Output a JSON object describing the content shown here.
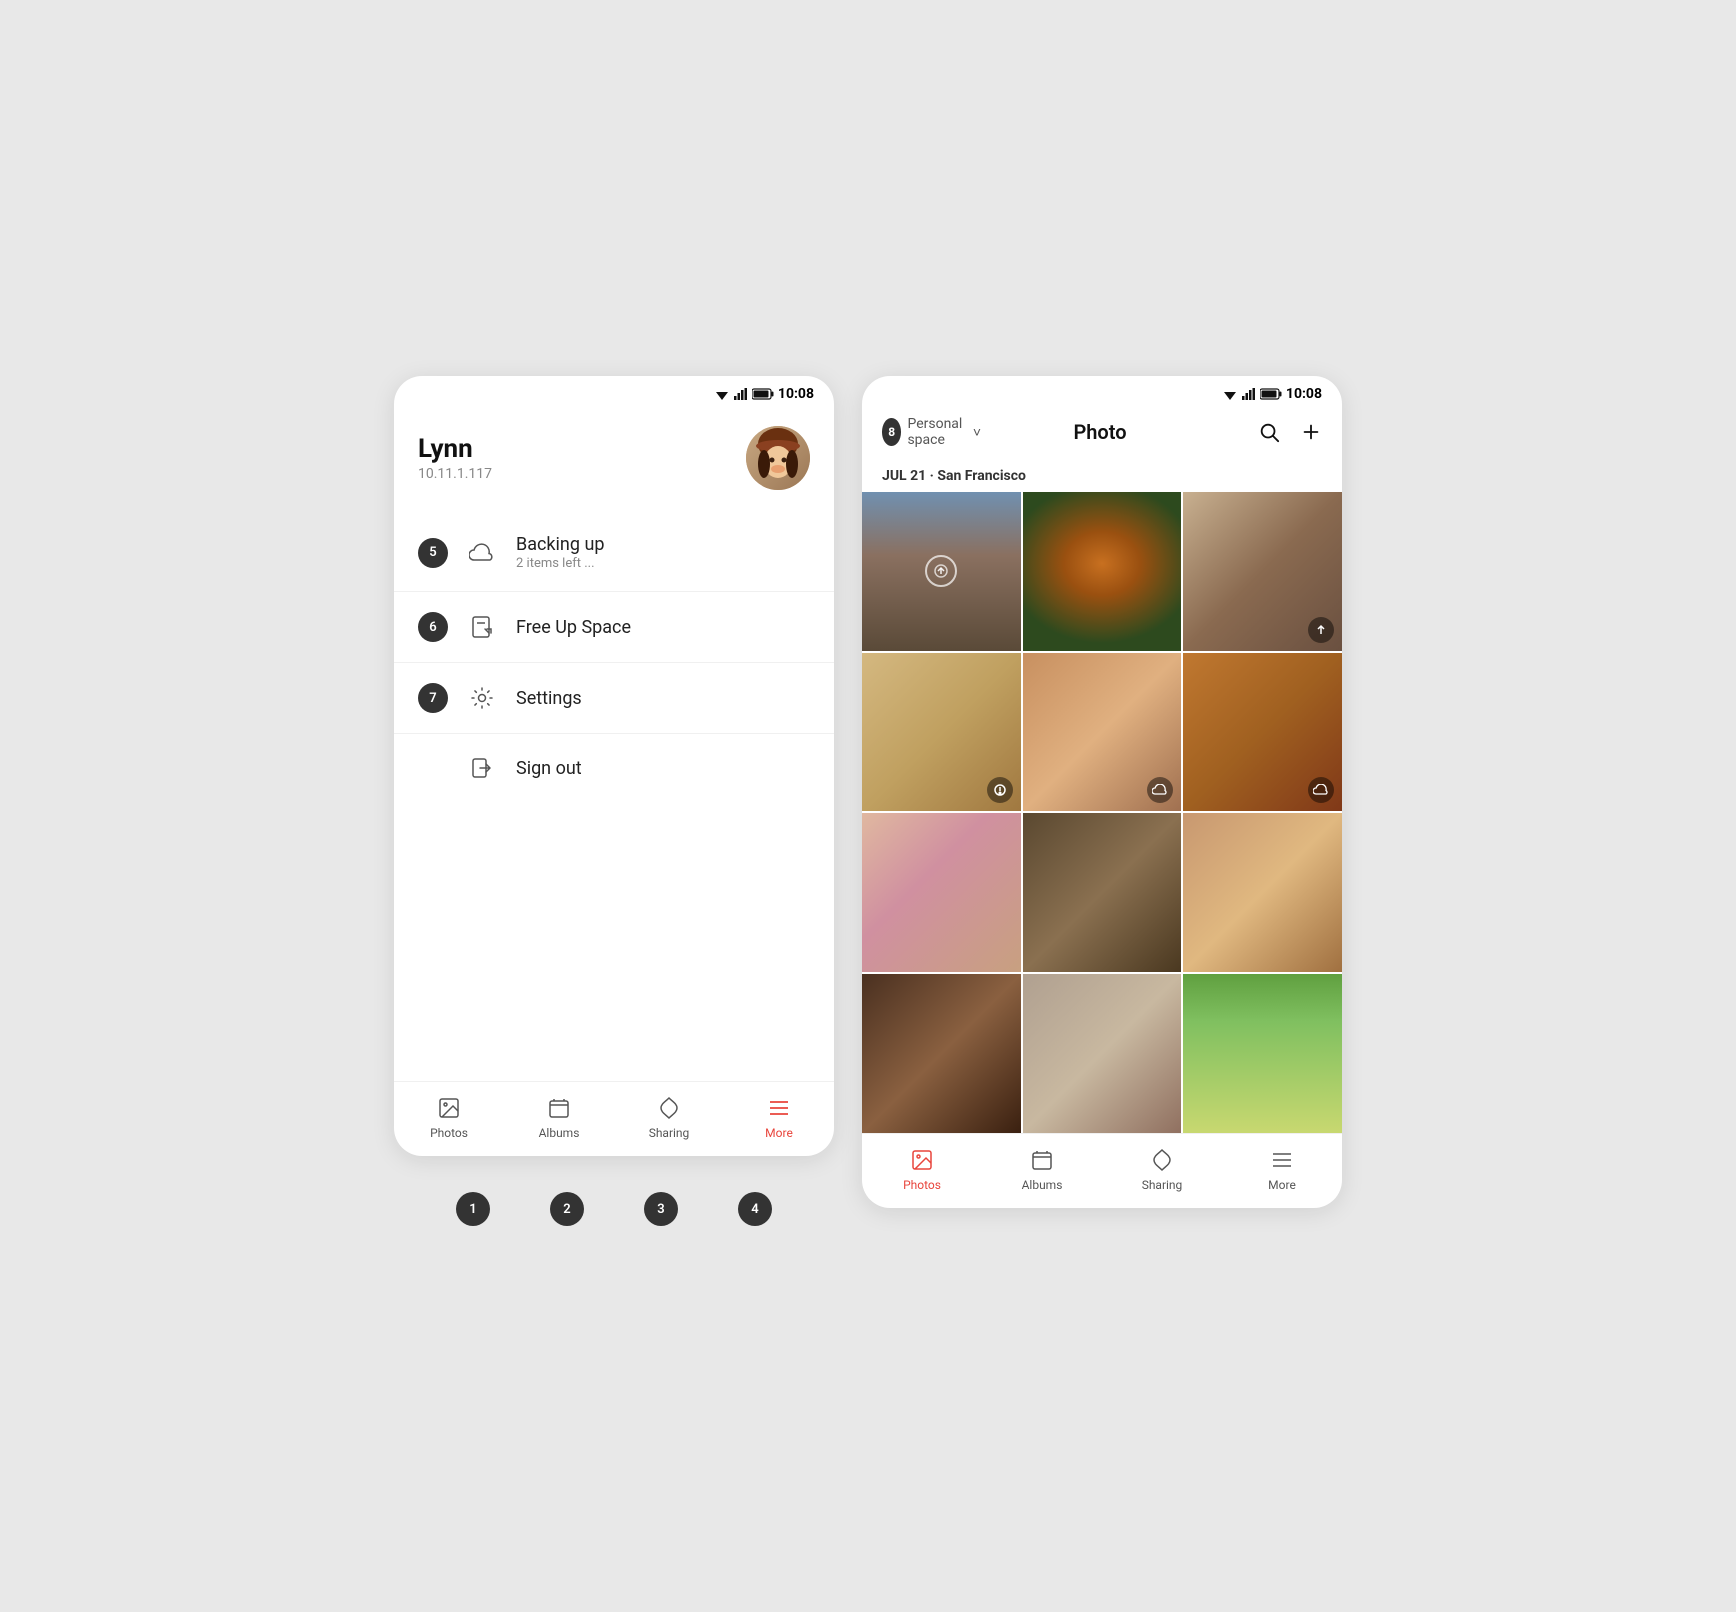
{
  "left_phone": {
    "status_bar": {
      "time": "10:08"
    },
    "profile": {
      "name": "Lynn",
      "ip": "10.11.1.117"
    },
    "menu_items": [
      {
        "id": "backup",
        "badge": "5",
        "title": "Backing up",
        "subtitle": "2 items left ...",
        "has_badge": true
      },
      {
        "id": "free-space",
        "badge": "6",
        "title": "Free Up Space",
        "subtitle": "",
        "has_badge": true
      },
      {
        "id": "settings",
        "badge": "7",
        "title": "Settings",
        "subtitle": "",
        "has_badge": true
      },
      {
        "id": "signout",
        "badge": "",
        "title": "Sign out",
        "subtitle": "",
        "has_badge": false
      }
    ],
    "bottom_nav": [
      {
        "id": "photos",
        "label": "Photos",
        "active": false
      },
      {
        "id": "albums",
        "label": "Albums",
        "active": false
      },
      {
        "id": "sharing",
        "label": "Sharing",
        "active": false
      },
      {
        "id": "more",
        "label": "More",
        "active": true
      }
    ],
    "bottom_indicators": [
      "1",
      "2",
      "3",
      "4"
    ]
  },
  "right_phone": {
    "status_bar": {
      "time": "10:08"
    },
    "header": {
      "title": "Photo",
      "badge": "8",
      "space_label": "Personal space",
      "space_caret": "›"
    },
    "date_section": {
      "label": "JUL 21 · San Francisco"
    },
    "photos": [
      {
        "id": "p1",
        "class": "building-overlay",
        "overlay": "upload-circle"
      },
      {
        "id": "p2",
        "class": "fox-overlay",
        "overlay": "none"
      },
      {
        "id": "p3",
        "class": "camper-overlay",
        "overlay": "upload-arrow"
      },
      {
        "id": "p4",
        "class": "couple-overlay",
        "overlay": "warning"
      },
      {
        "id": "p5",
        "class": "old-man-overlay",
        "overlay": "cloud"
      },
      {
        "id": "p6",
        "class": "guitar-overlay",
        "overlay": "cloud"
      },
      {
        "id": "p7",
        "class": "flowers-overlay",
        "overlay": "none"
      },
      {
        "id": "p8",
        "class": "bar-overlay",
        "overlay": "none"
      },
      {
        "id": "p9",
        "class": "smiling-man-overlay",
        "overlay": "none"
      },
      {
        "id": "p10",
        "class": "curly-woman-overlay",
        "overlay": "none"
      },
      {
        "id": "p11",
        "class": "two-women-overlay",
        "overlay": "none"
      },
      {
        "id": "p12",
        "class": "landscape-overlay",
        "overlay": "none"
      }
    ],
    "bottom_nav": [
      {
        "id": "photos",
        "label": "Photos",
        "active": true
      },
      {
        "id": "albums",
        "label": "Albums",
        "active": false
      },
      {
        "id": "sharing",
        "label": "Sharing",
        "active": false
      },
      {
        "id": "more",
        "label": "More",
        "active": false
      }
    ]
  }
}
